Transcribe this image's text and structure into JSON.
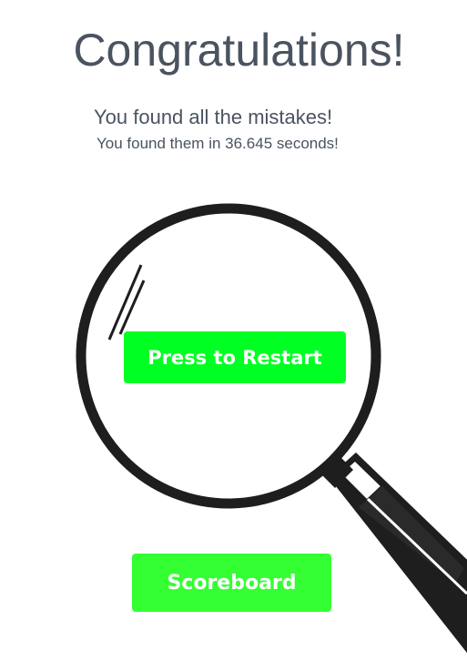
{
  "header": {
    "title": "Congratulations!",
    "message": "You found all the mistakes!",
    "time_message": "You found them in 36.645 seconds!"
  },
  "buttons": {
    "restart_label": "Press to Restart",
    "scoreboard_label": "Scoreboard"
  },
  "colors": {
    "text": "#4a5360",
    "button": "#33ff33",
    "button_text": "#ffffff",
    "magnifier": "#1e1e1e"
  },
  "icons": {
    "magnifier": "magnifying-glass-icon"
  }
}
